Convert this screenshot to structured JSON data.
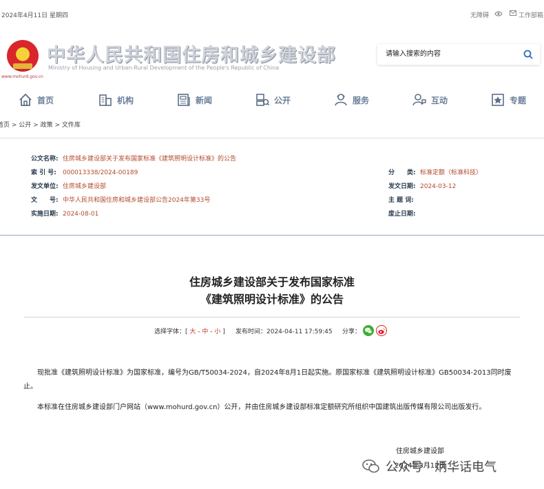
{
  "topbar": {
    "date": "2024年4月11日 星期四",
    "accessibility": "无障碍",
    "work_portal": "工作部箱"
  },
  "header": {
    "title_cn": "中华人民共和国住房和城乡建设部",
    "title_en": "Ministry of Housing and Urban-Rural Development of the People's Republic of China",
    "site_url": "www.mohurd.gov.cn",
    "search_placeholder": "请输入搜索的内容"
  },
  "nav": [
    {
      "label": "首页",
      "icon": "home-icon"
    },
    {
      "label": "机构",
      "icon": "building-icon"
    },
    {
      "label": "新闻",
      "icon": "news-icon"
    },
    {
      "label": "公开",
      "icon": "disclosure-icon"
    },
    {
      "label": "服务",
      "icon": "service-icon"
    },
    {
      "label": "互动",
      "icon": "interaction-icon"
    },
    {
      "label": "专题",
      "icon": "topic-icon"
    }
  ],
  "breadcrumb": [
    "首页",
    "公开",
    "政策",
    "文件库"
  ],
  "info": {
    "title_k": "公文名称:",
    "title_v": "住房城乡建设部关于发布国家标准《建筑照明设计标准》的公告",
    "index_k": "索 引 号:",
    "index_v": "000013338/2024-00189",
    "unit_k": "发文单位:",
    "unit_v": "住房城乡建设部",
    "docno_k": "文　　号:",
    "docno_v": "中华人民共和国住房和城乡建设部公告2024年第33号",
    "impl_k": "实施日期:",
    "impl_v": "2024-08-01",
    "cat_k": "分　　类:",
    "cat_v": "标准定额（标准科技）",
    "date_k": "发文日期:",
    "date_v": "2024-03-12",
    "subject_k": "主 题 词:",
    "subject_v": "",
    "abolish_k": "废止日期:",
    "abolish_v": ""
  },
  "article": {
    "title_line1": "住房城乡建设部关于发布国家标准",
    "title_line2": "《建筑照明设计标准》的公告",
    "font_label": "选择字体：[",
    "font_large": "大",
    "font_mid": "中",
    "font_small": "小",
    "font_end": "]",
    "sep": "-",
    "publish_time": "发布时间：2024-04-11 17:59:45",
    "share_label": "分享：",
    "para1": "现批准《建筑照明设计标准》为国家标准，编号为GB/T50034-2024，自2024年8月1日起实施。原国家标准《建筑照明设计标准》GB50034-2013同时废止。",
    "para2": "本标准在住房城乡建设部门户网站（www.mohurd.gov.cn）公开，并由住房城乡建设部标准定额研究所组织中国建筑出版传媒有限公司出版发行。",
    "sig_org": "住房城乡建设部",
    "sig_date": "2024年3月12日"
  },
  "watermark": "公众号 · 炳华话电气",
  "colors": {
    "accent": "#b14a2c",
    "nav_text": "#6a7f99",
    "wechat": "#3cb034",
    "weibo": "#e6162d"
  }
}
